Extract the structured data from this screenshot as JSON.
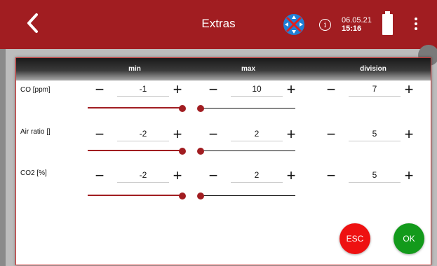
{
  "app": {
    "title": "Extras"
  },
  "status": {
    "date": "06.05.21",
    "time": "15:16"
  },
  "columns": {
    "min": "min",
    "max": "max",
    "division": "division"
  },
  "rows": [
    {
      "label": "CO [ppm]",
      "min": "-1",
      "max": "10",
      "division": "7",
      "min_level": 1.0,
      "max_level": 0.0
    },
    {
      "label": "Air ratio []",
      "min": "-2",
      "max": "2",
      "division": "5",
      "min_level": 1.0,
      "max_level": 0.0
    },
    {
      "label": "CO2 [%]",
      "min": "-2",
      "max": "2",
      "division": "5",
      "min_level": 1.0,
      "max_level": 0.0
    }
  ],
  "controls": {
    "minus": "−",
    "plus": "+"
  },
  "buttons": {
    "esc": "ESC",
    "ok": "OK"
  },
  "colors": {
    "primary": "#a11d21",
    "esc": "#ee1111",
    "ok": "#139a1b"
  },
  "icons": [
    "back-chevron-icon",
    "compass-icon",
    "info-icon",
    "battery-icon",
    "more-vert-icon"
  ]
}
